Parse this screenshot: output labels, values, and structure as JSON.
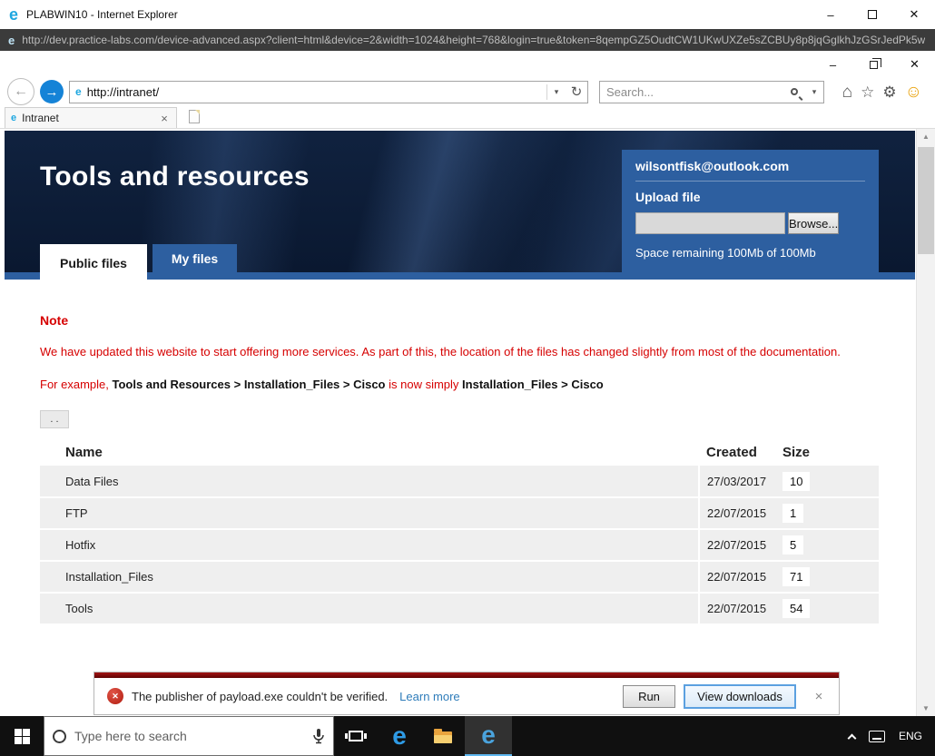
{
  "outer_window": {
    "title": "PLABWIN10 - Internet Explorer",
    "url": "http://dev.practice-labs.com/device-advanced.aspx?client=html&device=2&width=1024&height=768&login=true&token=8qempGZ5OudtCW1UKwUXZe5sZCBUy8p8jqGglkhJzGSrJedPk5w"
  },
  "browser": {
    "address": "http://intranet/",
    "search_placeholder": "Search...",
    "tab_title": "Intranet"
  },
  "page": {
    "title": "Tools and resources",
    "email": "wilsontfisk@outlook.com",
    "upload": {
      "heading": "Upload file",
      "browse": "Browse...",
      "space": "Space remaining 100Mb of 100Mb"
    },
    "tabs": [
      {
        "label": "Public files"
      },
      {
        "label": "My files"
      }
    ],
    "note": {
      "heading": "Note",
      "body": "We have updated this website to start offering more services. As part of this, the location of the files has changed slightly from most of the documentation.",
      "example_red1": "For example, ",
      "example_bold1": "Tools and Resources > Installation_Files > Cisco",
      "example_red2": " is now simply ",
      "example_bold2": "Installation_Files > Cisco"
    },
    "parent_button": ". .",
    "table": {
      "columns": [
        "Name",
        "Created",
        "Size"
      ],
      "rows": [
        {
          "name": "Data Files",
          "created": "27/03/2017",
          "size": "10"
        },
        {
          "name": "FTP",
          "created": "22/07/2015",
          "size": "1"
        },
        {
          "name": "Hotfix",
          "created": "22/07/2015",
          "size": "5"
        },
        {
          "name": "Installation_Files",
          "created": "22/07/2015",
          "size": "71"
        },
        {
          "name": "Tools",
          "created": "22/07/2015",
          "size": "54"
        }
      ]
    }
  },
  "download_bar": {
    "message": "The publisher of payload.exe couldn't be verified.",
    "learn_more": "Learn more",
    "run": "Run",
    "view_downloads": "View downloads"
  },
  "taskbar": {
    "search_placeholder": "Type here to search",
    "language": "ENG"
  },
  "icons": {
    "ie_logo": "e",
    "edge_logo": "e",
    "minimize": "–",
    "close": "✕",
    "back_arrow": "←",
    "forward_arrow": "→",
    "dropdown": "▾",
    "refresh": "↻",
    "home": "⌂",
    "star": "☆",
    "gear": "⚙",
    "smiley": "☺",
    "scroll_up": "▲",
    "scroll_down": "▼",
    "tab_close": "×",
    "notif_close": "×",
    "shield_x": "✕"
  },
  "colors": {
    "accent_blue": "#2d5fa0",
    "note_red": "#d60000",
    "header_navy": "#0c1c36",
    "taskbar_black": "#101010",
    "active_underline_blue": "#5fb8f0"
  }
}
